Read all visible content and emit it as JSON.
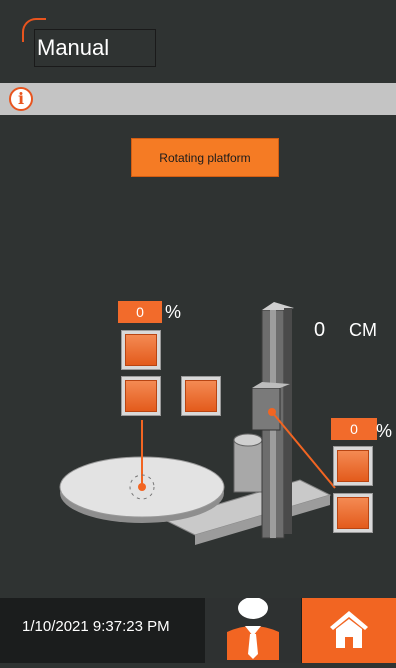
{
  "header": {
    "title": "Manual"
  },
  "info_bar": {
    "icon": "info-icon",
    "text": ""
  },
  "controls": {
    "rotating_platform_label": "Rotating platform"
  },
  "platform": {
    "speed_value": "0",
    "speed_unit": "%"
  },
  "carriage": {
    "speed_value": "0",
    "speed_unit": "%"
  },
  "tower": {
    "height_value": "0",
    "height_unit": "CM"
  },
  "footer": {
    "datetime": "1/10/2021 9:37:23 PM"
  },
  "colors": {
    "accent": "#f26522",
    "background": "#2f3332",
    "info_bar": "#c4c4c4"
  }
}
